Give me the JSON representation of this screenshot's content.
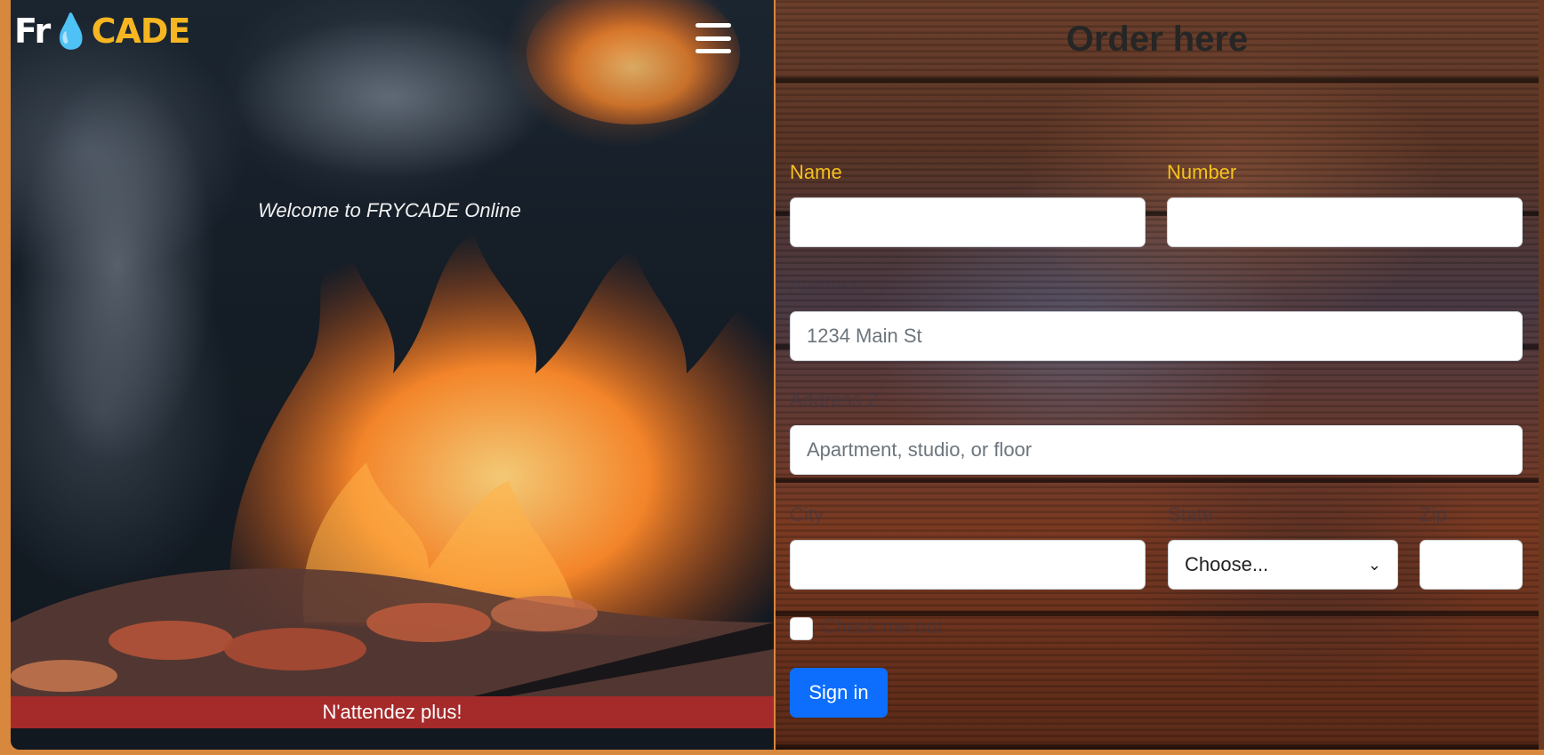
{
  "brand": {
    "logo_part1": "Fr",
    "logo_part2": "CADE",
    "logo_alt": "FrYCADE"
  },
  "hero": {
    "welcome_text": "Welcome to FRYCADE Online",
    "banner_text": "N'attendez plus!",
    "menu_icon": "hamburger-menu-icon"
  },
  "order_form": {
    "title": "Order here",
    "name_label": "Name",
    "number_label": "Number",
    "address_label": "Address",
    "address_placeholder": "1234 Main St",
    "address2_label": "Address 2",
    "address2_placeholder": "Apartment, studio, or floor",
    "city_label": "City",
    "state_label": "State",
    "state_selected": "Choose...",
    "zip_label": "Zip",
    "checkbox_label": "Check me out",
    "submit_label": "Sign in"
  },
  "colors": {
    "page_border": "#d8873f",
    "accent_yellow": "#f6c21c",
    "banner_red": "#a52a2a",
    "button_blue": "#0d6efd"
  }
}
